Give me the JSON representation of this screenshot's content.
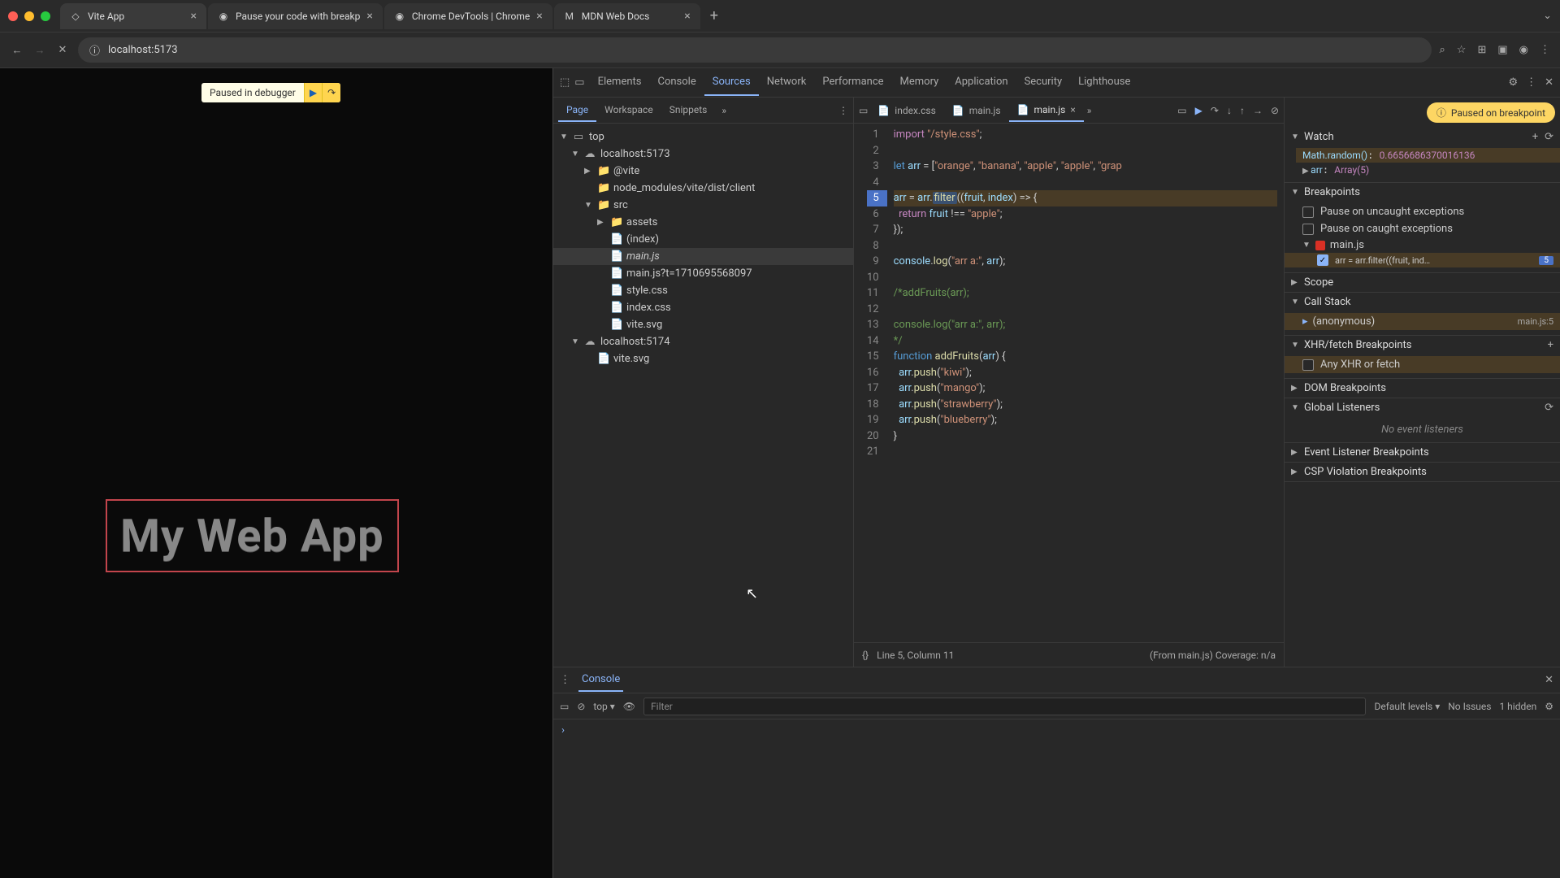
{
  "tabs": [
    {
      "title": "Vite App",
      "icon": "page"
    },
    {
      "title": "Pause your code with breakp",
      "icon": "chrome"
    },
    {
      "title": "Chrome DevTools | Chrome",
      "icon": "chrome"
    },
    {
      "title": "MDN Web Docs",
      "icon": "mdn"
    }
  ],
  "address": "localhost:5173",
  "debugger": {
    "label": "Paused in debugger"
  },
  "app": {
    "heading": "My Web App"
  },
  "devtools": {
    "tabs": [
      "Elements",
      "Console",
      "Sources",
      "Network",
      "Performance",
      "Memory",
      "Application",
      "Security",
      "Lighthouse"
    ],
    "activeTab": "Sources",
    "navigator": {
      "tabs": [
        "Page",
        "Workspace",
        "Snippets"
      ],
      "active": "Page",
      "tree": [
        {
          "arrow": "▼",
          "icon": "▭",
          "name": "top",
          "ind": 0
        },
        {
          "arrow": "▼",
          "icon": "☁",
          "name": "localhost:5173",
          "ind": 1
        },
        {
          "arrow": "▶",
          "icon": "📁",
          "name": "@vite",
          "ind": 2
        },
        {
          "arrow": "",
          "icon": "📁",
          "name": "node_modules/vite/dist/client",
          "ind": 2
        },
        {
          "arrow": "▼",
          "icon": "📁",
          "name": "src",
          "ind": 2
        },
        {
          "arrow": "▶",
          "icon": "📁",
          "name": "assets",
          "ind": 3
        },
        {
          "arrow": "",
          "icon": "📄",
          "name": "(index)",
          "ind": 3
        },
        {
          "arrow": "",
          "icon": "📄",
          "name": "main.js",
          "ind": 3,
          "sel": true,
          "italic": true
        },
        {
          "arrow": "",
          "icon": "📄",
          "name": "main.js?t=1710695568097",
          "ind": 3
        },
        {
          "arrow": "",
          "icon": "📄",
          "name": "style.css",
          "ind": 3
        },
        {
          "arrow": "",
          "icon": "📄",
          "name": "index.css",
          "ind": 3
        },
        {
          "arrow": "",
          "icon": "📄",
          "name": "vite.svg",
          "ind": 3
        },
        {
          "arrow": "▼",
          "icon": "☁",
          "name": "localhost:5174",
          "ind": 1
        },
        {
          "arrow": "",
          "icon": "📄",
          "name": "vite.svg",
          "ind": 2
        }
      ]
    },
    "editor": {
      "openTabs": [
        {
          "name": "index.css",
          "active": false
        },
        {
          "name": "main.js",
          "active": false
        },
        {
          "name": "main.js",
          "active": true
        }
      ],
      "breakpointLine": 5,
      "code": [
        {
          "n": 1,
          "html": "<span class='kw'>import</span> <span class='str'>\"/style.css\"</span>;"
        },
        {
          "n": 2,
          "html": ""
        },
        {
          "n": 3,
          "html": "<span class='decl'>let</span> <span class='var'>arr</span> = [<span class='str'>\"orange\"</span>, <span class='str'>\"banana\"</span>, <span class='str'>\"apple\"</span>, <span class='str'>\"apple\"</span>, <span class='str'>\"grap</span>"
        },
        {
          "n": 4,
          "html": ""
        },
        {
          "n": 5,
          "html": "<span class='var'>arr</span> = <span class='var'>arr</span>.<span class='fn filter-token'>filter</span>((<span class='var'>fruit</span>, <span class='var'>index</span>) =&gt; {",
          "hl": true
        },
        {
          "n": 6,
          "html": "  <span class='kw'>return</span> <span class='var'>fruit</span> !== <span class='str'>\"apple\"</span>;"
        },
        {
          "n": 7,
          "html": "});"
        },
        {
          "n": 8,
          "html": ""
        },
        {
          "n": 9,
          "html": "<span class='var'>console</span>.<span class='fn'>log</span>(<span class='str'>\"arr a:\"</span>, <span class='var'>arr</span>);"
        },
        {
          "n": 10,
          "html": ""
        },
        {
          "n": 11,
          "html": "<span class='com'>/*addFruits(arr);</span>"
        },
        {
          "n": 12,
          "html": ""
        },
        {
          "n": 13,
          "html": "<span class='com'>console.log(\"arr a:\", arr);</span>"
        },
        {
          "n": 14,
          "html": "<span class='com'>*/</span>"
        },
        {
          "n": 15,
          "html": "<span class='decl'>function</span> <span class='fn'>addFruits</span>(<span class='var'>arr</span>) {"
        },
        {
          "n": 16,
          "html": "  <span class='var'>arr</span>.<span class='fn'>push</span>(<span class='str'>\"kiwi\"</span>);"
        },
        {
          "n": 17,
          "html": "  <span class='var'>arr</span>.<span class='fn'>push</span>(<span class='str'>\"mango\"</span>);"
        },
        {
          "n": 18,
          "html": "  <span class='var'>arr</span>.<span class='fn'>push</span>(<span class='str'>\"strawberry\"</span>);"
        },
        {
          "n": 19,
          "html": "  <span class='var'>arr</span>.<span class='fn'>push</span>(<span class='str'>\"blueberry\"</span>);"
        },
        {
          "n": 20,
          "html": "}"
        },
        {
          "n": 21,
          "html": ""
        }
      ],
      "status": {
        "pos": "Line 5, Column 11",
        "from": "(From main.js) Coverage: n/a"
      }
    },
    "right": {
      "pausedPill": "Paused on breakpoint",
      "watch": {
        "title": "Watch",
        "items": [
          {
            "k": "Math.random()",
            "v": "0.6656686370016136",
            "hl": true
          },
          {
            "k": "arr",
            "v": "Array(5)",
            "arrow": true
          }
        ]
      },
      "breakpoints": {
        "title": "Breakpoints",
        "pauseUncaught": "Pause on uncaught exceptions",
        "pauseCaught": "Pause on caught exceptions",
        "file": "main.js",
        "line": {
          "text": "arr = arr.filter((fruit, ind…",
          "num": "5"
        }
      },
      "scope": {
        "title": "Scope"
      },
      "callStack": {
        "title": "Call Stack",
        "items": [
          {
            "name": "(anonymous)",
            "loc": "main.js:5"
          }
        ]
      },
      "xhr": {
        "title": "XHR/fetch Breakpoints",
        "any": "Any XHR or fetch"
      },
      "dom": {
        "title": "DOM Breakpoints"
      },
      "global": {
        "title": "Global Listeners",
        "empty": "No event listeners"
      },
      "eventListener": {
        "title": "Event Listener Breakpoints"
      },
      "csp": {
        "title": "CSP Violation Breakpoints"
      }
    }
  },
  "console": {
    "tab": "Console",
    "context": "top",
    "filterPlaceholder": "Filter",
    "levels": "Default levels",
    "issues": "No Issues",
    "hidden": "1 hidden"
  }
}
